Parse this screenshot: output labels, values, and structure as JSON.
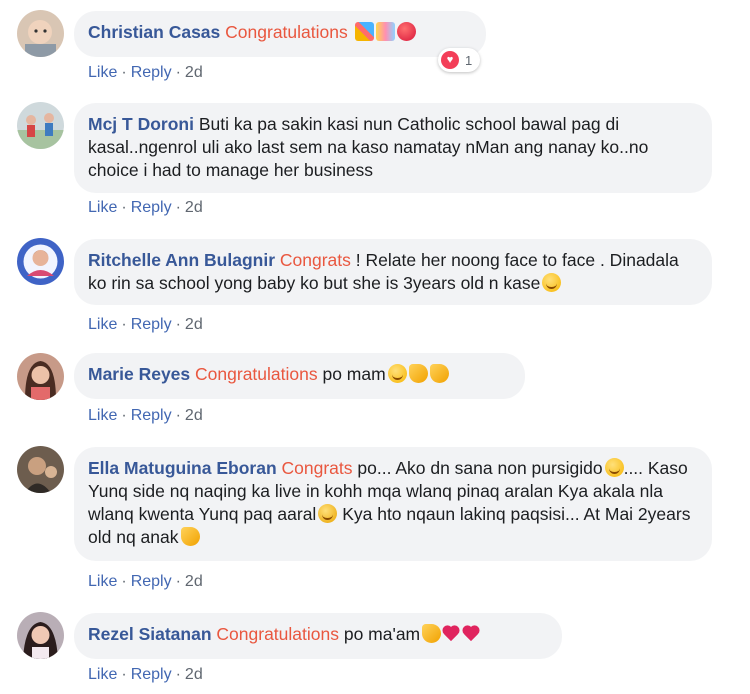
{
  "actions": {
    "like": "Like",
    "reply": "Reply",
    "sep": "·"
  },
  "comments": [
    {
      "author": "Christian Casas",
      "highlight": "Congratulations",
      "text": "",
      "emojis": [
        "party-popper-emoji",
        "confetti-emoji",
        "balloon-emoji"
      ],
      "time": "2d",
      "reaction": {
        "icon": "heart-reaction-icon",
        "count": "1"
      }
    },
    {
      "author": "Mcj T Doroni",
      "highlight": "",
      "text": "Buti ka pa sakin kasi nun Catholic school bawal pag di kasal..ngenrol uli ako last sem na kaso namatay nMan ang nanay ko..no choice i had to manage her business",
      "time": "2d"
    },
    {
      "author": "Ritchelle Ann Bulagnir",
      "highlight": "Congrats",
      "text": " ! Relate her noong face to face . Dinadala ko rin sa school yong baby ko but she is 3years old n kase",
      "emojis": [
        "grinning-face-emoji"
      ],
      "time": "2d"
    },
    {
      "author": "Marie Reyes",
      "highlight": "Congratulations",
      "text": " po mam",
      "emojis": [
        "smiling-face-emoji",
        "clapping-hands-emoji",
        "clapping-hands-emoji"
      ],
      "time": "2d"
    },
    {
      "author": "Ella Matuguina Eboran",
      "highlight": "Congrats",
      "text_a": " po... Ako dn sana non pursigido",
      "text_b": ".... Kaso Yunq side nq naqing ka live in kohh mqa wlanq pinaq aralan Kya akala nla wlanq kwenta Yunq paq aaral",
      "text_c": " Kya hto nqaun lakinq paqsisi... At Mai 2years old nq anak",
      "time": "2d"
    },
    {
      "author": "Rezel Siatanan",
      "highlight": "Congratulations",
      "text": " po ma'am",
      "emojis": [
        "clapping-hands-emoji",
        "red-heart-emoji",
        "red-heart-emoji"
      ],
      "time": "2d"
    }
  ]
}
